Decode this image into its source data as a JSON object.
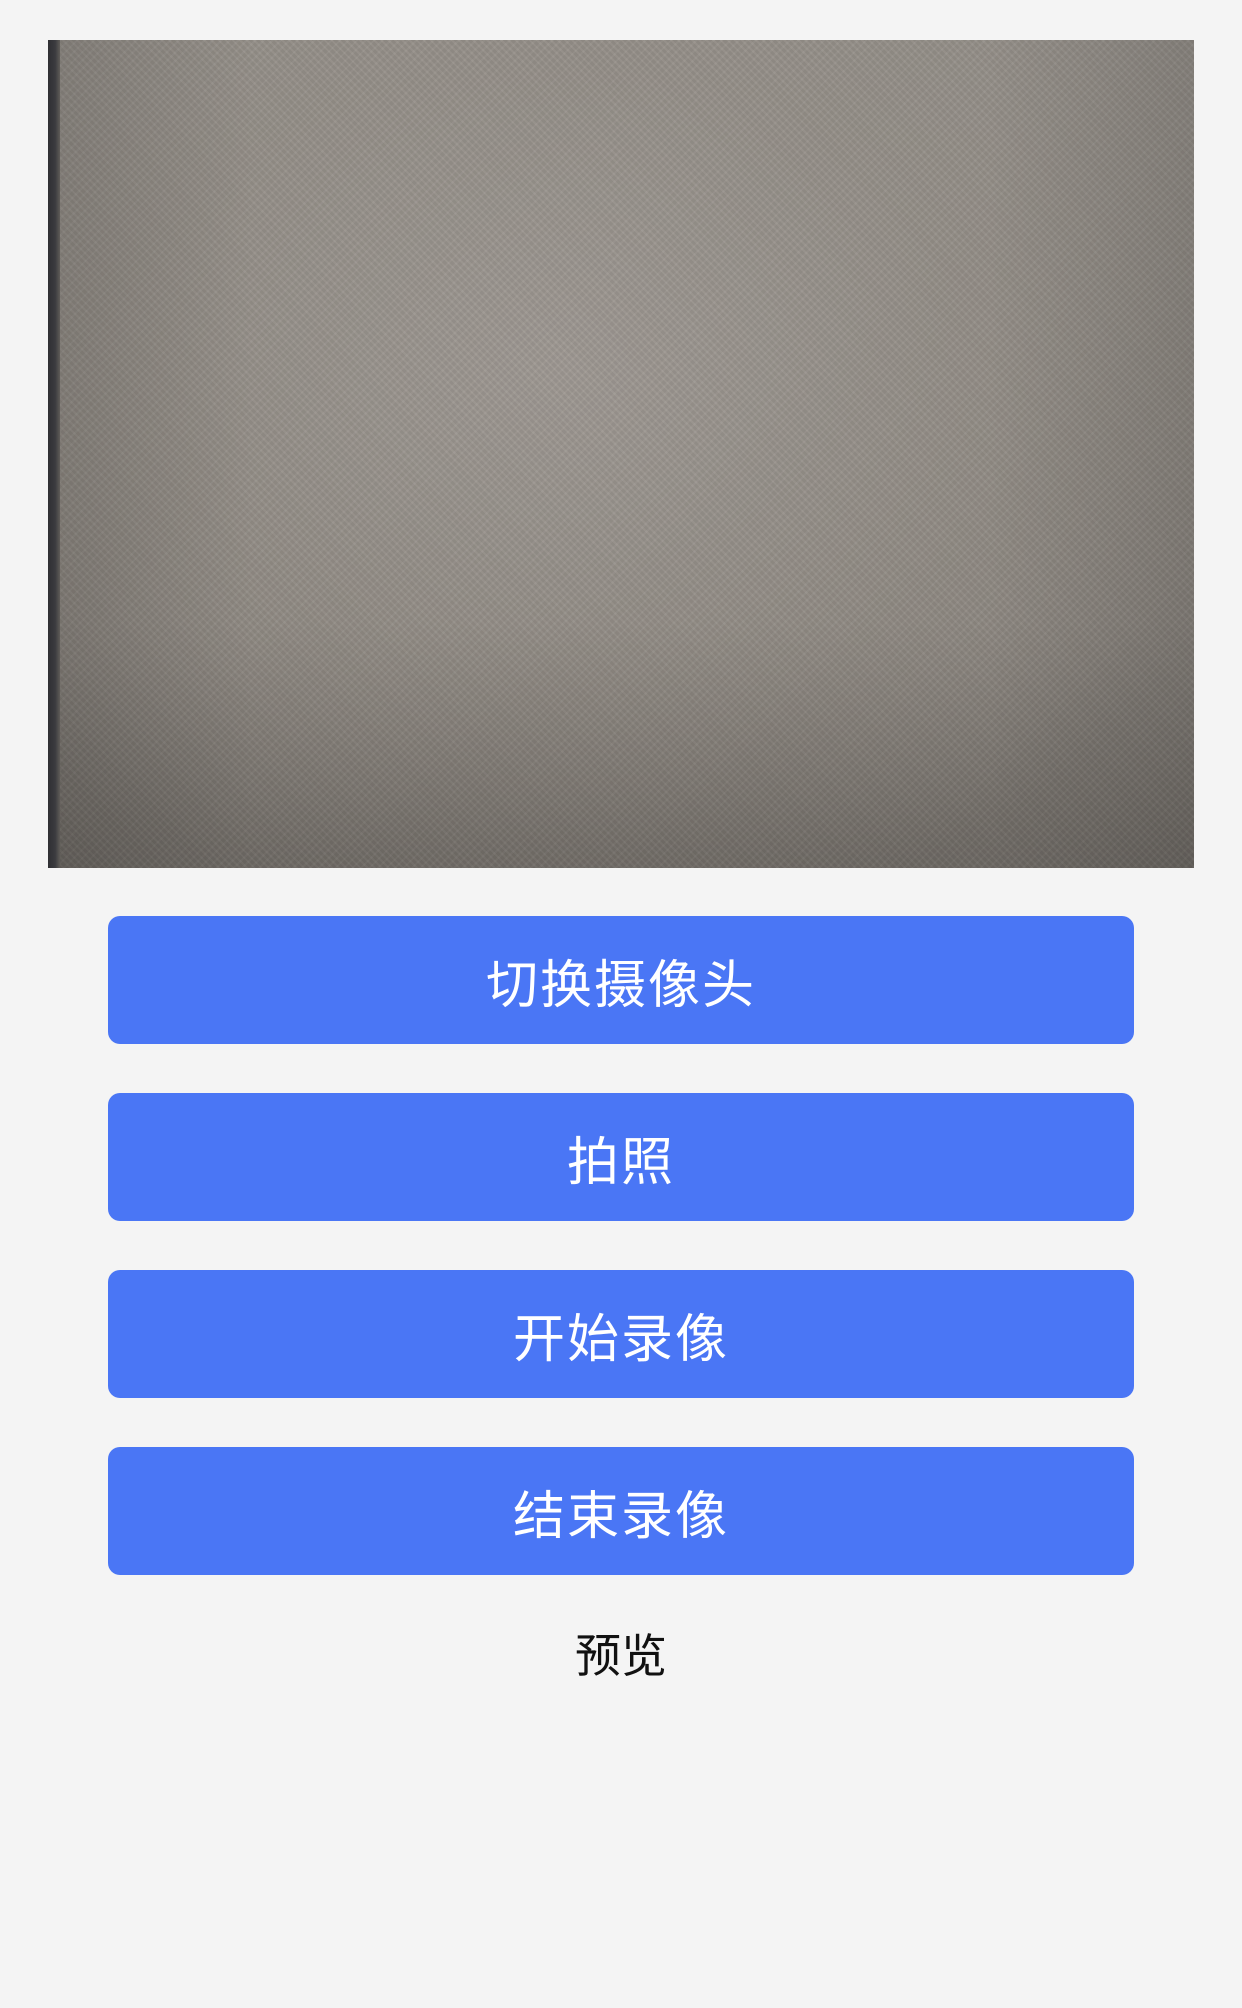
{
  "camera": {
    "state": "preview"
  },
  "buttons": {
    "switch_camera": "切换摄像头",
    "take_photo": "拍照",
    "start_recording": "开始录像",
    "stop_recording": "结束录像"
  },
  "preview_link": "预览",
  "colors": {
    "background": "#f4f4f4",
    "button": "#4a76f5",
    "button_text": "#ffffff",
    "link_text": "#111111"
  }
}
